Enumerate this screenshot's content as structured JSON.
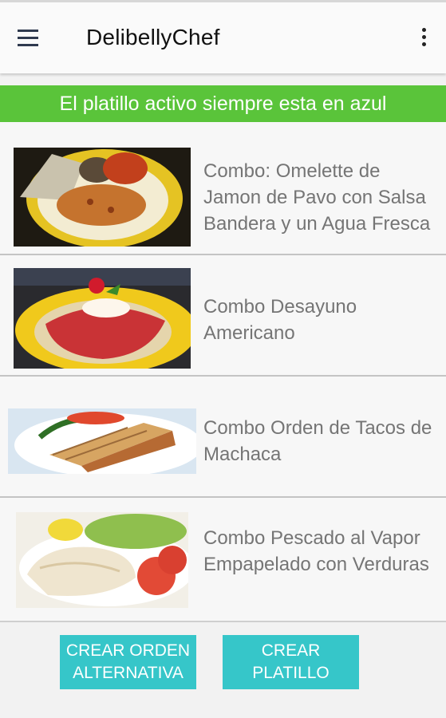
{
  "appbar": {
    "title": "DelibellyChef",
    "menu_icon": "hamburger-icon",
    "more_icon": "more-vert-icon"
  },
  "banner": {
    "text": "El platillo activo siempre esta en azul",
    "color": "#5ac43a"
  },
  "dishes": [
    {
      "name": "Combo: Omelette de Jamon de Pavo con Salsa Bandera y un Agua Fresca"
    },
    {
      "name": "Combo Desayuno Americano"
    },
    {
      "name": "Combo Orden de Tacos de Machaca"
    },
    {
      "name": "Combo Pescado al Vapor Empapelado con Verduras"
    }
  ],
  "actions": {
    "alt_order_label": "CREAR ORDEN ALTERNATIVA",
    "create_dish_label": "CREAR PLATILLO",
    "button_color": "#36c6c9"
  }
}
